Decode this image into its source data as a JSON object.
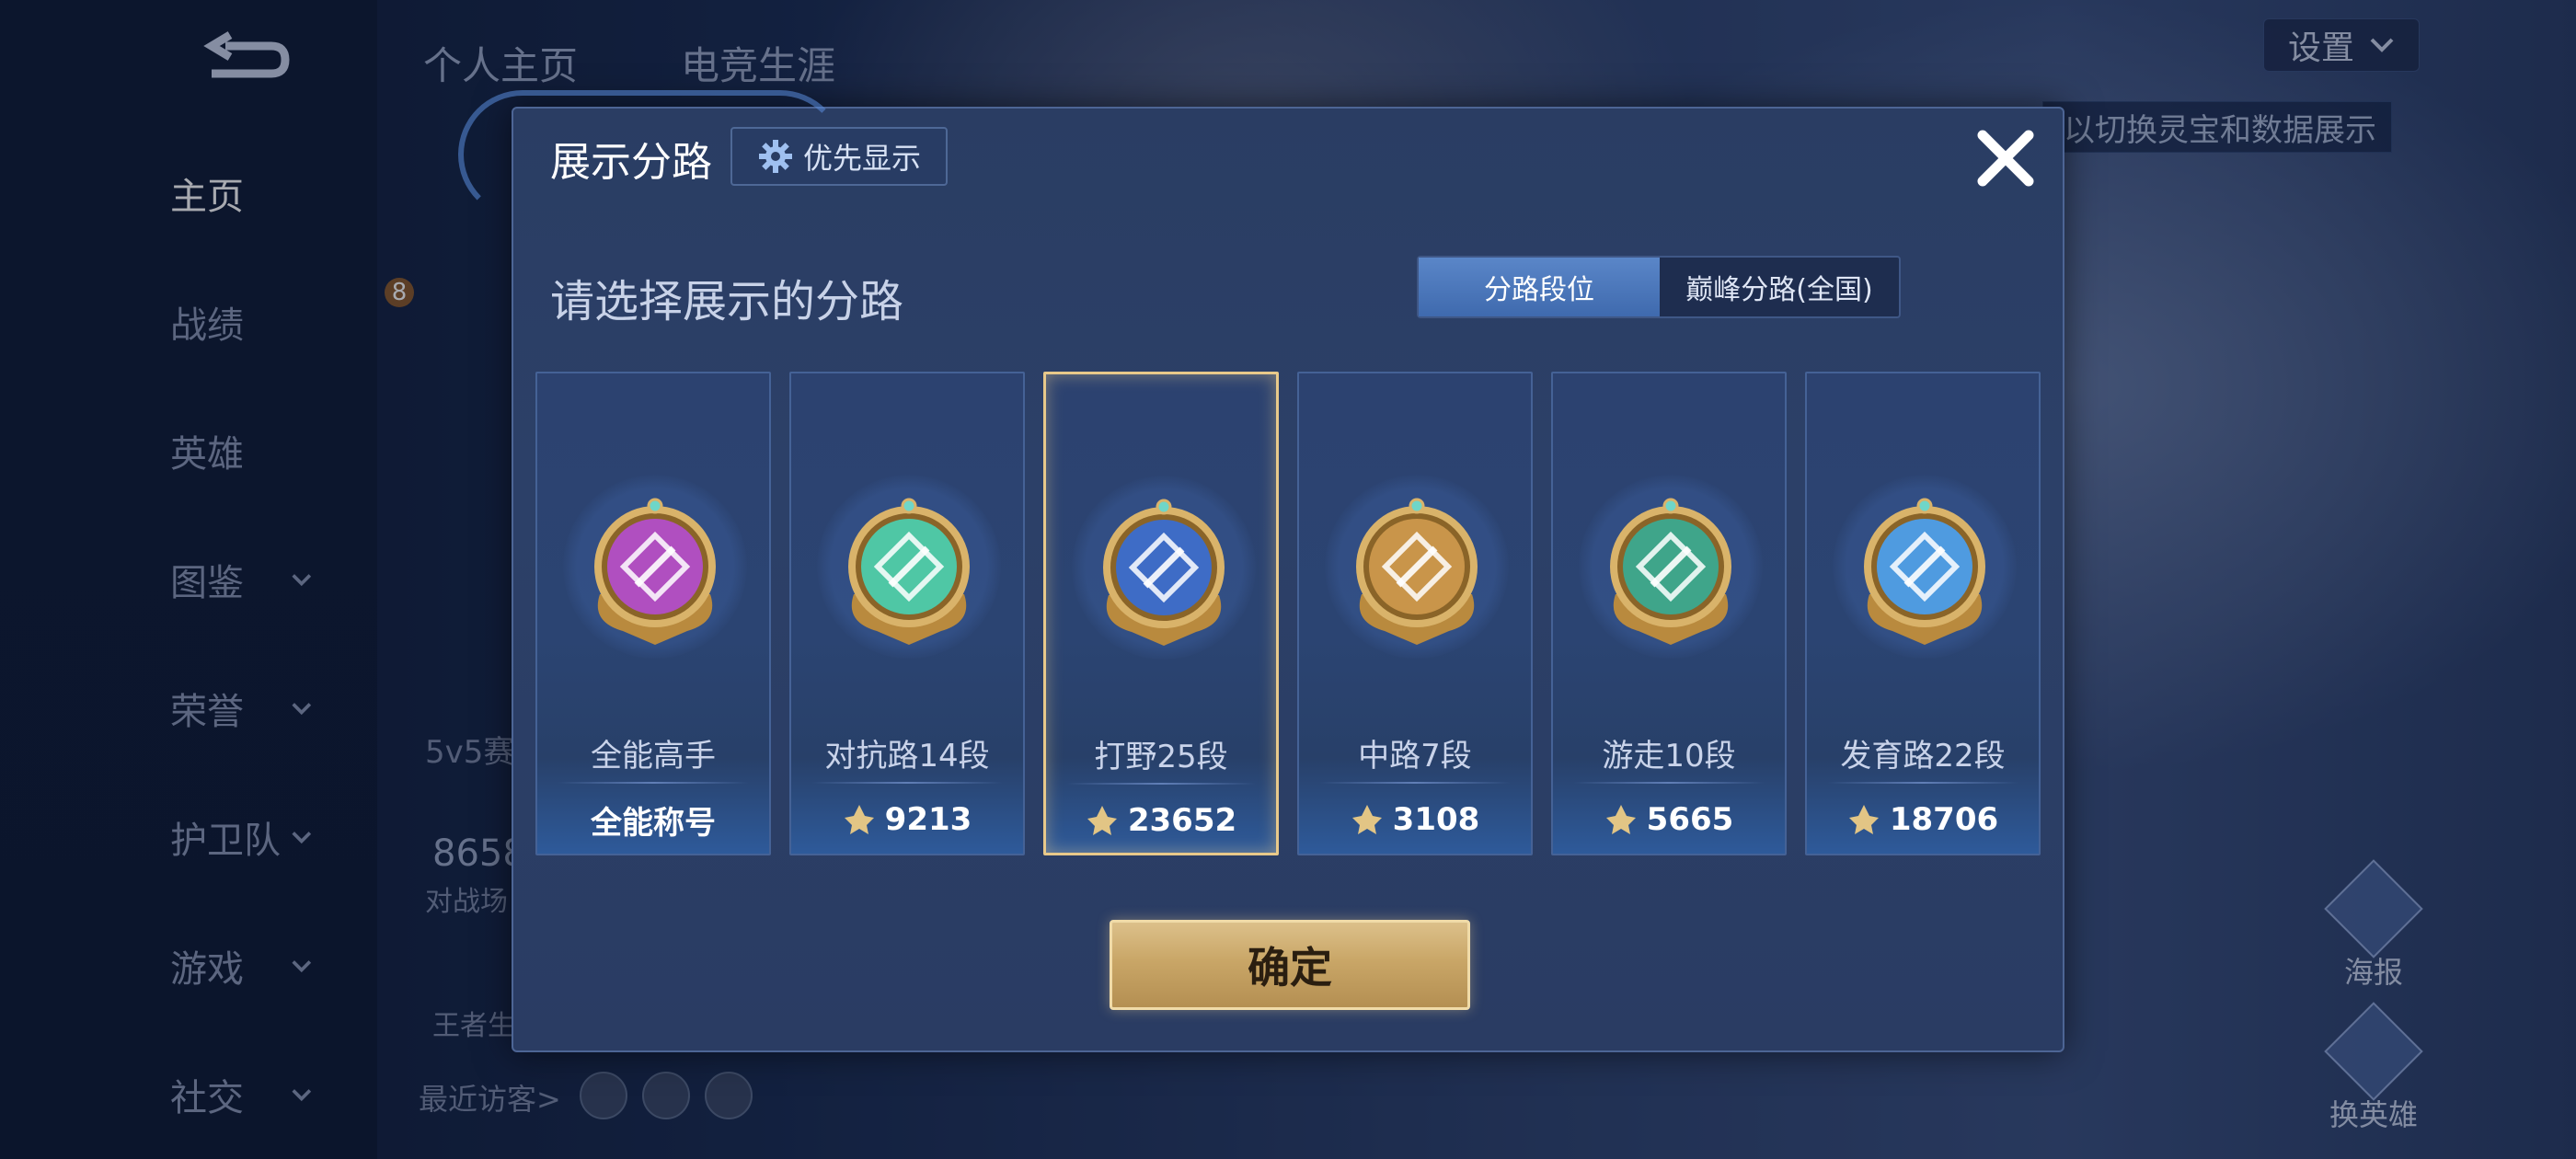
{
  "background": {
    "top_tabs": [
      "个人主页",
      "电竞生涯"
    ],
    "settings_label": "设置",
    "hint_text": "以切换灵宝和数据展示",
    "nav": [
      {
        "label": "主页",
        "active": true,
        "has_chevron": false
      },
      {
        "label": "战绩",
        "active": false,
        "has_chevron": false
      },
      {
        "label": "英雄",
        "active": false,
        "has_chevron": false
      },
      {
        "label": "图鉴",
        "active": false,
        "has_chevron": true
      },
      {
        "label": "荣誉",
        "active": false,
        "has_chevron": true
      },
      {
        "label": "护卫队",
        "active": false,
        "has_chevron": true
      },
      {
        "label": "游戏",
        "active": false,
        "has_chevron": true
      },
      {
        "label": "社交",
        "active": false,
        "has_chevron": true
      }
    ],
    "level_badge": "8",
    "mode_text": "5v5赛",
    "stat_number": "8658",
    "stat_label": "对战场",
    "misc_label": "王者生",
    "visitors_label": "最近访客>",
    "fab_poster": "海报",
    "fab_change_hero": "换英雄"
  },
  "modal": {
    "title": "展示分路",
    "priority_label": "优先显示",
    "subtitle": "请选择展示的分路",
    "toggle": {
      "options": [
        "分路段位",
        "巅峰分路(全国)"
      ],
      "selected": "分路段位"
    },
    "cards": [
      {
        "lane": "全能高手",
        "score": "全能称号",
        "has_points_icon": false,
        "emblem_color": "#b04fc0",
        "icon": "allround-icon",
        "selected": false
      },
      {
        "lane": "对抗路14段",
        "score": "9213",
        "has_points_icon": true,
        "emblem_color": "#4fc7a5",
        "icon": "clash-lane-icon",
        "selected": false
      },
      {
        "lane": "打野25段",
        "score": "23652",
        "has_points_icon": true,
        "emblem_color": "#3e6cc6",
        "icon": "jungle-icon",
        "selected": true
      },
      {
        "lane": "中路7段",
        "score": "3108",
        "has_points_icon": true,
        "emblem_color": "#c9954a",
        "icon": "mid-lane-icon",
        "selected": false
      },
      {
        "lane": "游走10段",
        "score": "5665",
        "has_points_icon": true,
        "emblem_color": "#3fa58a",
        "icon": "roam-icon",
        "selected": false
      },
      {
        "lane": "发育路22段",
        "score": "18706",
        "has_points_icon": true,
        "emblem_color": "#4f9be0",
        "icon": "farm-lane-icon",
        "selected": false
      }
    ],
    "confirm_label": "确定"
  }
}
